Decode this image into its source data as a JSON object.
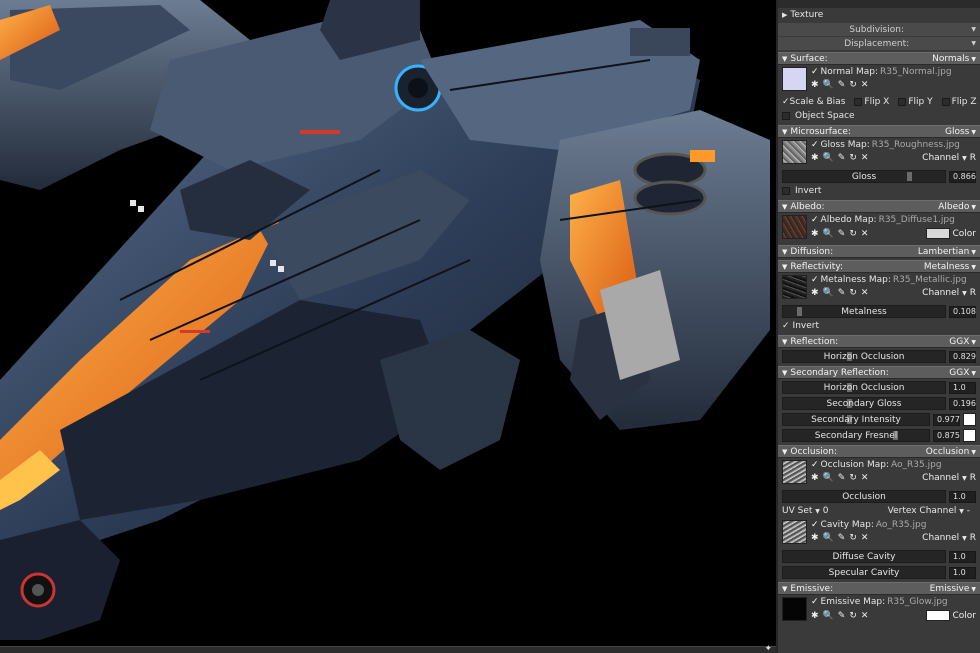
{
  "panel": {
    "texture": {
      "label": "Texture"
    },
    "subdivision": {
      "label": "Subdivision:"
    },
    "displacement": {
      "label": "Displacement:"
    },
    "surface": {
      "label": "Surface:",
      "value": "Normals",
      "map_label": "Normal Map:",
      "map_file": "R35_Normal.jpg",
      "scale_bias": "Scale & Bias",
      "flip_x": "Flip X",
      "flip_y": "Flip Y",
      "flip_z": "Flip Z",
      "object_space": "Object Space"
    },
    "microsurface": {
      "label": "Microsurface:",
      "value": "Gloss",
      "map_label": "Gloss Map:",
      "map_file": "R35_Roughness.jpg",
      "channel_label": "Channel",
      "channel_value": "R",
      "slider_label": "Gloss",
      "slider_value": "0.866",
      "invert": "Invert"
    },
    "albedo": {
      "label": "Albedo:",
      "value": "Albedo",
      "map_label": "Albedo Map:",
      "map_file": "R35_Diffuse1.jpg",
      "color_label": "Color"
    },
    "diffusion": {
      "label": "Diffusion:",
      "value": "Lambertian"
    },
    "reflectivity": {
      "label": "Reflectivity:",
      "value": "Metalness",
      "map_label": "Metalness Map:",
      "map_file": "R35_Metallic.jpg",
      "channel_label": "Channel",
      "channel_value": "R",
      "slider_label": "Metalness",
      "slider_value": "0.108",
      "invert": "Invert"
    },
    "reflection": {
      "label": "Reflection:",
      "value": "GGX",
      "horizon_label": "Horizon Occlusion",
      "horizon_value": "0.829"
    },
    "secondary_reflection": {
      "label": "Secondary Reflection:",
      "value": "GGX",
      "horizon_label": "Horizon Occlusion",
      "horizon_value": "1.0",
      "gloss_label": "Secondary Gloss",
      "gloss_value": "0.196",
      "intensity_label": "Secondary Intensity",
      "intensity_value": "0.977",
      "fresnel_label": "Secondary Fresnel",
      "fresnel_value": "0.875"
    },
    "occlusion": {
      "label": "Occlusion:",
      "value": "Occlusion",
      "map_label": "Occlusion Map:",
      "map_file": "Ao_R35.jpg",
      "channel_label": "Channel",
      "channel_value": "R",
      "slider_label": "Occlusion",
      "slider_value": "1.0",
      "uv_label": "UV Set",
      "uv_value": "0",
      "vertex_label": "Vertex Channel",
      "vertex_value": "-",
      "cavity_label": "Cavity Map:",
      "cavity_file": "Ao_R35.jpg",
      "cavity_channel_label": "Channel",
      "cavity_channel_value": "R",
      "diffuse_cavity_label": "Diffuse Cavity",
      "diffuse_cavity_value": "1.0",
      "specular_cavity_label": "Specular Cavity",
      "specular_cavity_value": "1.0"
    },
    "emissive": {
      "label": "Emissive:",
      "value": "Emissive",
      "map_label": "Emissive Map:",
      "map_file": "R35_Glow.jpg",
      "color_label": "Color"
    }
  },
  "icons": {
    "check": "✓",
    "gear": "✱",
    "search": "🔍",
    "eyedropper": "✎",
    "reload": "↻",
    "clear": "✕",
    "expand": "▶",
    "collapse": "▼",
    "dropdown": "▼"
  }
}
